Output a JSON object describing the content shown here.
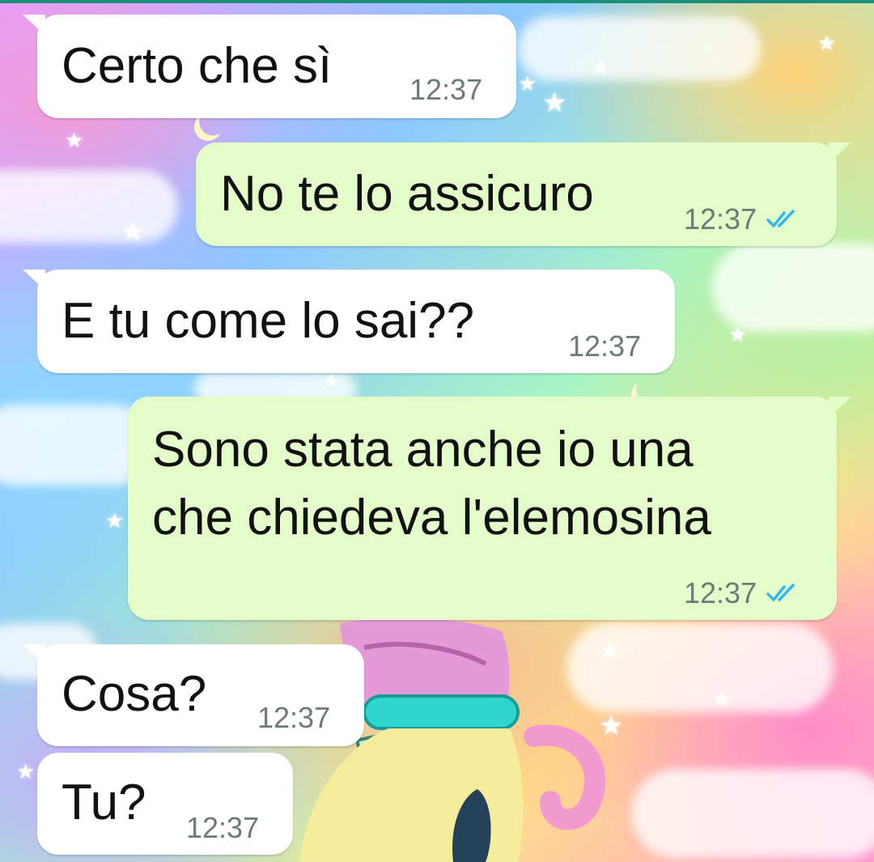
{
  "chat": {
    "messages": [
      {
        "direction": "incoming",
        "text": "Certo che sì",
        "time": "12:37"
      },
      {
        "direction": "outgoing",
        "text": "No te lo assicuro",
        "time": "12:37",
        "status": "read"
      },
      {
        "direction": "incoming",
        "text": "E tu come lo sai??",
        "time": "12:37"
      },
      {
        "direction": "outgoing",
        "lines": [
          "Sono stata anche io una",
          "che chiedeva l'elemosina"
        ],
        "time": "12:37",
        "status": "read"
      },
      {
        "direction": "incoming",
        "text": "Cosa?",
        "time": "12:37"
      },
      {
        "direction": "incoming",
        "text": "Tu?",
        "time": "12:37"
      }
    ]
  },
  "colors": {
    "incoming_bubble": "#ffffff",
    "outgoing_bubble": "#e4fcc9",
    "read_ticks": "#34b7f1",
    "timestamp": "#6b7b76"
  },
  "icons": {
    "read_receipt": "double-check-icon"
  }
}
